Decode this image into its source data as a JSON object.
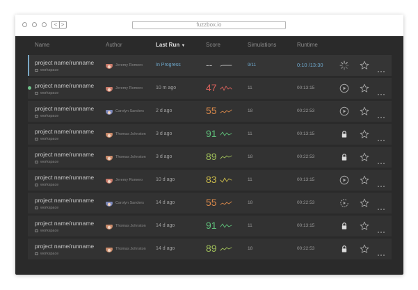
{
  "browser": {
    "url": "fuzzbox.io",
    "back_label": "<",
    "forward_label": ">"
  },
  "table": {
    "columns": {
      "name": "Name",
      "author": "Author",
      "last_run": "Last Run",
      "score": "Score",
      "simulations": "Simulations",
      "runtime": "Runtime"
    },
    "sort_indicator": "▼",
    "rows": [
      {
        "project": "project name/runname",
        "workspace": "workspace",
        "author": "Jeremy Romero",
        "avatar_color": "#c97a6a",
        "last_run": "In Progress",
        "score": "--",
        "score_color": "#bbbbbb",
        "spark_color": "#bbbbbb",
        "simulations": "9/11",
        "runtime": "0:10 /13:30",
        "status_icon": "spinner-icon",
        "status": "in-progress"
      },
      {
        "project": "project name/runname",
        "workspace": "workspace",
        "author": "Jeremy Romero",
        "avatar_color": "#c97a6a",
        "last_run": "10 m ago",
        "score": "47",
        "score_color": "#d4605a",
        "spark_color": "#d4605a",
        "simulations": "11",
        "runtime": "00:13:15",
        "status_icon": "play-icon",
        "status": "running-dot"
      },
      {
        "project": "project name/runname",
        "workspace": "workspace",
        "author": "Carolyn Sanders",
        "avatar_color": "#7a86b8",
        "last_run": "2 d ago",
        "score": "55",
        "score_color": "#d8884a",
        "spark_color": "#d8884a",
        "simulations": "18",
        "runtime": "00:22:53",
        "status_icon": "play-icon",
        "status": "idle"
      },
      {
        "project": "project name/runname",
        "workspace": "workspace",
        "author": "Thomas Johnston",
        "avatar_color": "#c98a6a",
        "last_run": "3 d ago",
        "score": "91",
        "score_color": "#5fbf7a",
        "spark_color": "#5fbf7a",
        "simulations": "11",
        "runtime": "00:13:15",
        "status_icon": "lock-icon",
        "status": "locked"
      },
      {
        "project": "project name/runname",
        "workspace": "workspace",
        "author": "Thomas Johnston",
        "avatar_color": "#c98a6a",
        "last_run": "3 d ago",
        "score": "89",
        "score_color": "#9fbf5a",
        "spark_color": "#9fbf5a",
        "simulations": "18",
        "runtime": "00:22:53",
        "status_icon": "lock-icon",
        "status": "locked"
      },
      {
        "project": "project name/runname",
        "workspace": "workspace",
        "author": "Jeremy Romero",
        "avatar_color": "#c97a6a",
        "last_run": "10 d ago",
        "score": "83",
        "score_color": "#c8b84a",
        "spark_color": "#c8b84a",
        "simulations": "11",
        "runtime": "00:13:15",
        "status_icon": "play-icon",
        "status": "idle"
      },
      {
        "project": "project name/runname",
        "workspace": "workspace",
        "author": "Carolyn Sanders",
        "avatar_color": "#7a86b8",
        "last_run": "14 d ago",
        "score": "55",
        "score_color": "#d8884a",
        "spark_color": "#d8884a",
        "simulations": "18",
        "runtime": "00:22:53",
        "status_icon": "replay-icon",
        "status": "idle"
      },
      {
        "project": "project name/runname",
        "workspace": "workspace",
        "author": "Thomas Johnston",
        "avatar_color": "#c98a6a",
        "last_run": "14 d ago",
        "score": "91",
        "score_color": "#5fbf7a",
        "spark_color": "#5fbf7a",
        "simulations": "11",
        "runtime": "00:13:15",
        "status_icon": "lock-icon",
        "status": "locked"
      },
      {
        "project": "project name/runname",
        "workspace": "workspace",
        "author": "Thomas Johnston",
        "avatar_color": "#c98a6a",
        "last_run": "14 d ago",
        "score": "89",
        "score_color": "#9fbf5a",
        "spark_color": "#9fbf5a",
        "simulations": "18",
        "runtime": "00:22:53",
        "status_icon": "lock-icon",
        "status": "locked"
      }
    ]
  },
  "colors": {
    "app_bg": "#2a2a2a",
    "row_bg": "#323232",
    "accent": "#6ea8cc",
    "selection_bar": "#7aa7c4"
  }
}
